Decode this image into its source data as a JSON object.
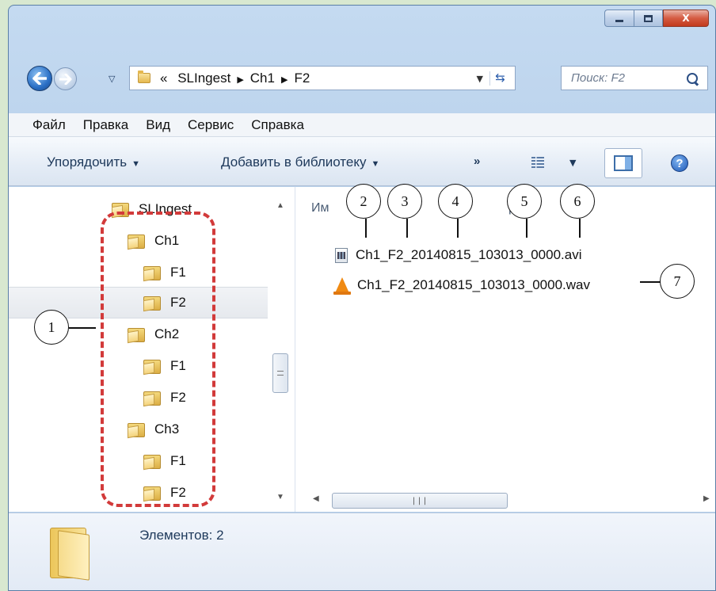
{
  "window": {
    "buttons": {
      "minimize_icon": "minimize-icon",
      "maximize_icon": "maximize-icon",
      "close_label": "X"
    }
  },
  "address_bar": {
    "prefix": "«",
    "crumbs": [
      "SLIngest",
      "Ch1",
      "F2"
    ]
  },
  "search": {
    "placeholder": "Поиск: F2"
  },
  "menu": [
    "Файл",
    "Правка",
    "Вид",
    "Сервис",
    "Справка"
  ],
  "toolbar": {
    "organize": "Упорядочить",
    "add_to_library": "Добавить в библиотеку",
    "more": "»"
  },
  "nav_tree": {
    "root": "SLIngest",
    "items": [
      {
        "label": "Ch1",
        "level": 1
      },
      {
        "label": "F1",
        "level": 2
      },
      {
        "label": "F2",
        "level": 2,
        "selected": true
      },
      {
        "label": "Ch2",
        "level": 1
      },
      {
        "label": "F1",
        "level": 2
      },
      {
        "label": "F2",
        "level": 2
      },
      {
        "label": "Ch3",
        "level": 1
      },
      {
        "label": "F1",
        "level": 2
      },
      {
        "label": "F2",
        "level": 2
      }
    ]
  },
  "file_list": {
    "header_name": "Им",
    "header_second": "Д",
    "files": [
      {
        "name": "Ch1_F2_20140815_103013_0000.avi",
        "icon": "video-file-icon"
      },
      {
        "name": "Ch1_F2_20140815_103013_0000.wav",
        "icon": "vlc-cone-icon"
      }
    ]
  },
  "details": {
    "text": "Элементов: 2"
  },
  "annotations": [
    "1",
    "2",
    "3",
    "4",
    "5",
    "6",
    "7"
  ],
  "colors": {
    "annotation_dash": "#d23a3a",
    "window_frame": "#c4daf1"
  }
}
